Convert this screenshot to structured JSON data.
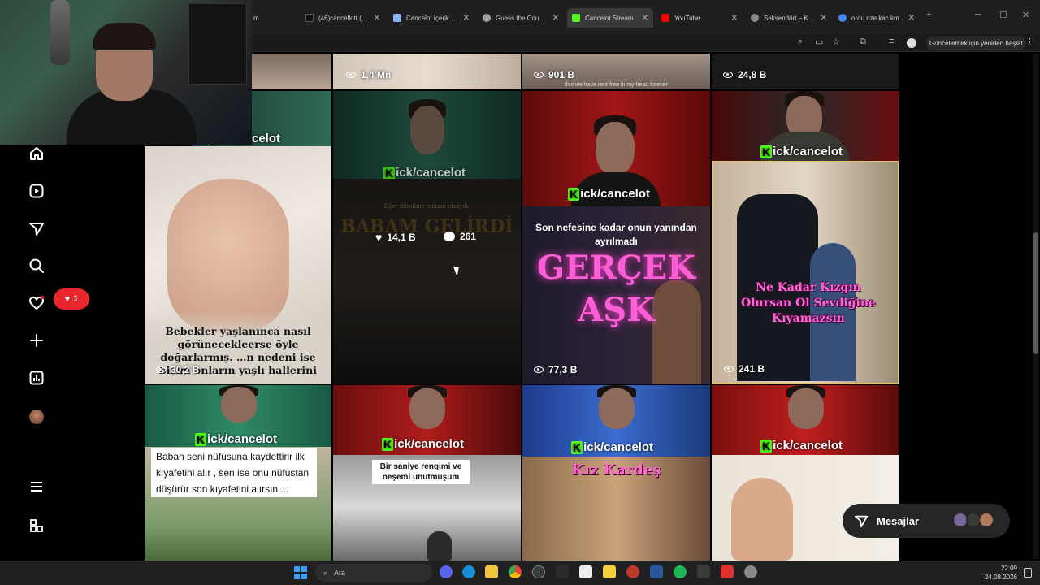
{
  "browser": {
    "tabs": [
      {
        "label": "m",
        "color": "#555"
      },
      {
        "label": "(46)cancellott (@…",
        "color": "#111"
      },
      {
        "label": "Cancelot İçerik St…",
        "color": "#8ab4f8"
      },
      {
        "label": "Guess the Country…",
        "color": "#9aa0a6"
      },
      {
        "label": "Cancelot Stream",
        "color": "#53fc18"
      },
      {
        "label": "YouTube",
        "color": "#ff0000"
      },
      {
        "label": "Seksendört – Ken…",
        "color": "#888"
      },
      {
        "label": "ordu nze kac km",
        "color": "#4285f4"
      }
    ],
    "update_button": "Güncellemek için yeniden başlat"
  },
  "tiles": {
    "r0c1_views": "1,4 Mn",
    "r0c2_views": "901 B",
    "r0c2_caption": "this we have rent free in my head forever",
    "r0c3_views": "24,8 B",
    "r1c0_caption": "Bebekler yaşlanınca nasıl görünecekleerse öyle doğarlarmış. …n nedeni ise bizim onların yaşlı hallerini",
    "r1c0_views": "30,2 B",
    "r1c1_likes": "14,1 B",
    "r1c1_comments": "261",
    "r1c1_bg_title": "BABAM GELİRDİ",
    "r1c1_bg_sub": "Eğer dönülme imkanı olsaydı,",
    "r1c2_caption_top": "Son nefesine kadar onun yanından ayrılmadı",
    "r1c2_caption_big1": "GERÇEK",
    "r1c2_caption_big2": "AŞK",
    "r1c2_views": "77,3 B",
    "r1c3_caption": "Ne Kadar Kızgın Olursan Ol Sevdiğine Kıyamazsın",
    "r1c3_views": "241 B",
    "r2c0_caption": "Baban seni nüfusuna kaydettirir ilk kıyafetini alır , sen ise onu nüfustan düşürür son kıyafetini alırsın ...",
    "r2c1_caption": "Bir saniye rengimi ve neşemi unutmuşum",
    "r2c2_caption": "Kız Kardeş"
  },
  "kick_label": "ick/cancelot",
  "kick_k": "K",
  "notifications": {
    "count": "1"
  },
  "messages": {
    "label": "Mesajlar"
  },
  "taskbar": {
    "search_placeholder": "Ara",
    "time": "22:09",
    "date": "24.08.2026"
  }
}
